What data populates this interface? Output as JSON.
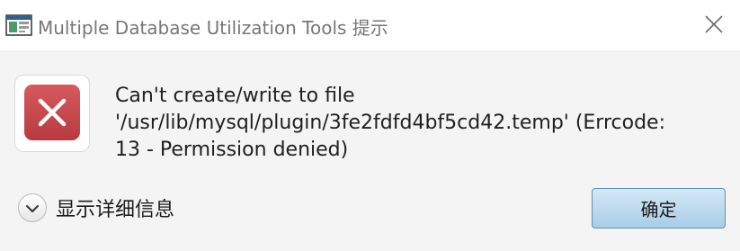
{
  "window": {
    "title": "Multiple Database Utilization Tools 提示",
    "app_icon": "app-window-icon",
    "close_icon": "close-icon"
  },
  "dialog": {
    "icon": "error-x-icon",
    "message_lines": [
      "Can't create/write to file",
      "'/usr/lib/mysql/plugin/3fe2fdfd4bf5cd42.temp' (Errcode:",
      "13 - Permission denied)"
    ],
    "details_icon": "chevron-down-icon",
    "details_label": "显示详细信息",
    "ok_label": "确定"
  },
  "colors": {
    "error_red": "#c9464a",
    "button_blue": "#b9d8ec",
    "button_border": "#5f8fb3"
  }
}
